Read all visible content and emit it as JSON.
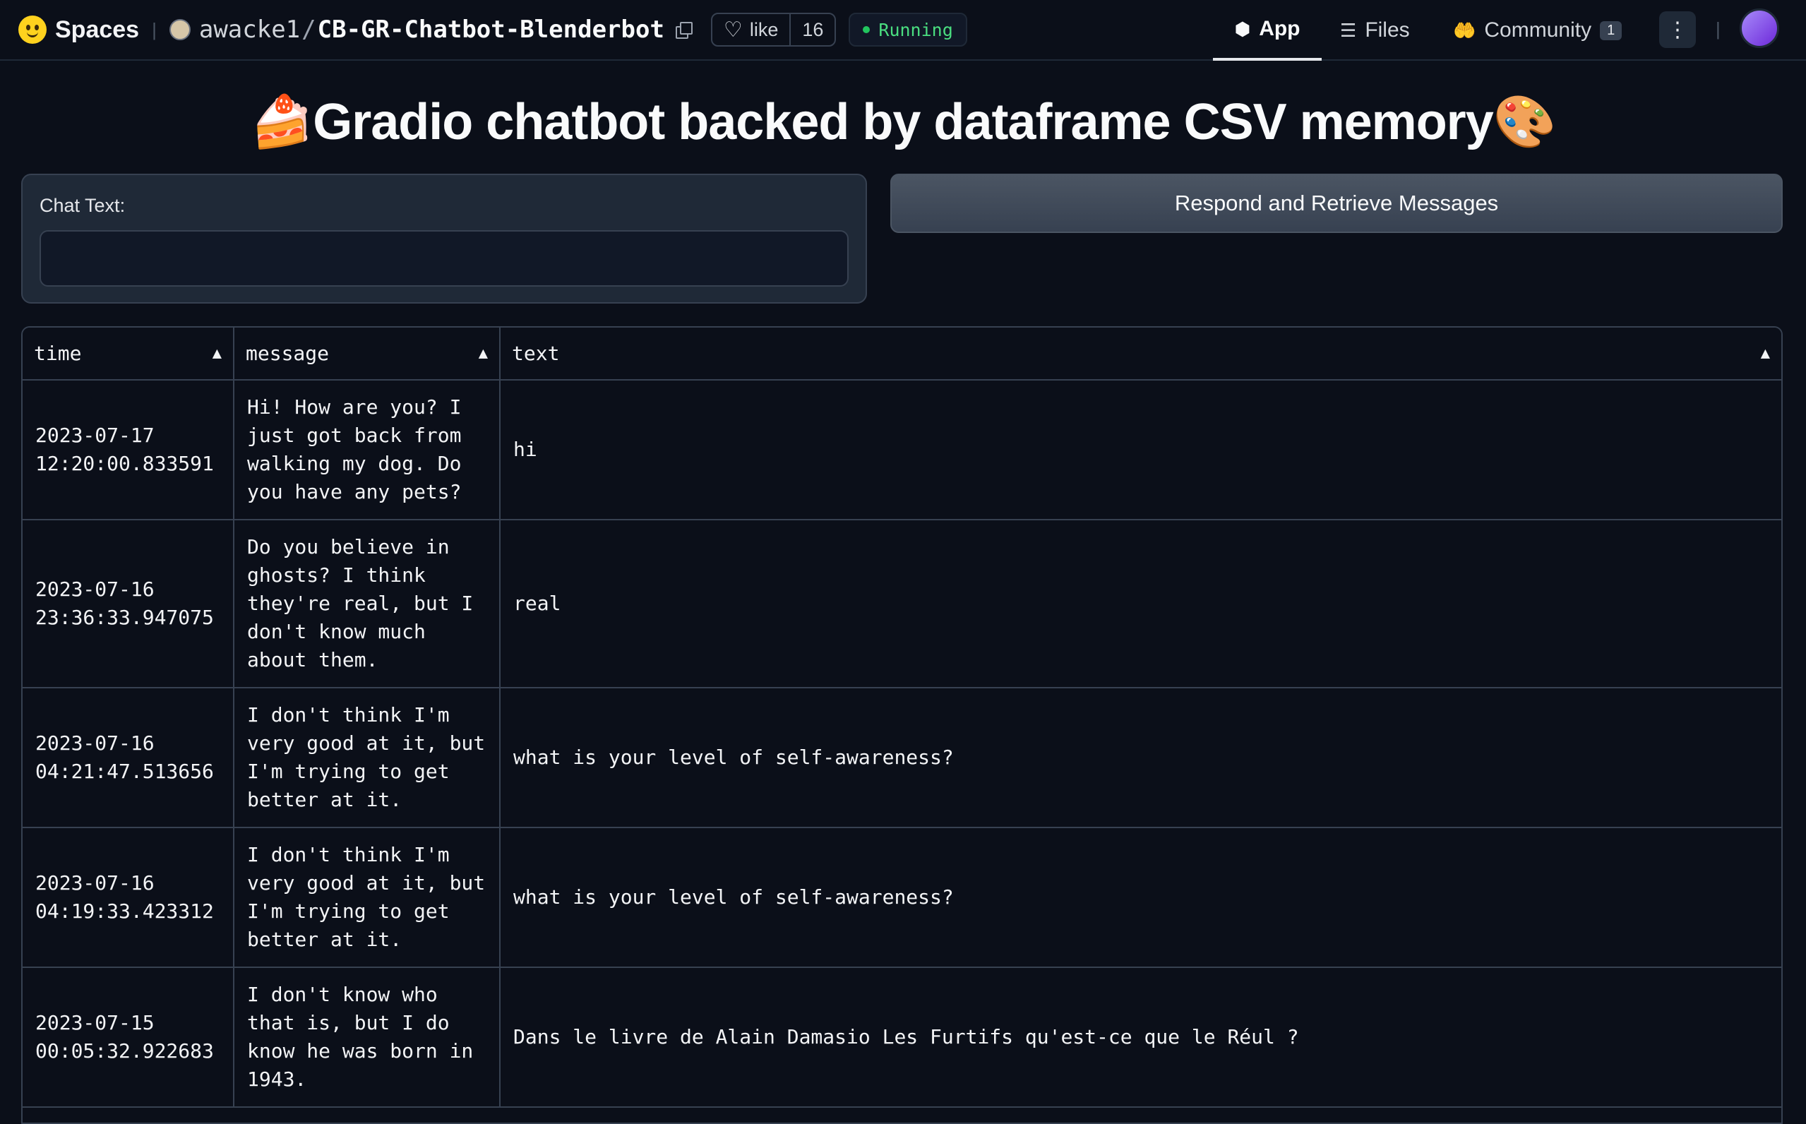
{
  "topbar": {
    "brand": "Spaces",
    "owner": "awacke1",
    "repo": "CB-GR-Chatbot-Blenderbot",
    "like_label": "like",
    "like_count": "16",
    "status": "Running",
    "nav": {
      "app": "App",
      "files": "Files",
      "community": "Community",
      "community_badge": "1"
    }
  },
  "page": {
    "title": "🍰Gradio chatbot backed by dataframe CSV memory🎨"
  },
  "chat": {
    "label": "Chat Text:",
    "value": "",
    "button_label": "Respond and Retrieve Messages"
  },
  "table": {
    "columns": [
      "time",
      "message",
      "text"
    ],
    "rows": [
      {
        "time": "2023-07-17\n12:20:00.833591",
        "message": "Hi! How are you? I\njust got back from\nwalking my dog. Do\nyou have any pets?",
        "text": "hi"
      },
      {
        "time": "2023-07-16\n23:36:33.947075",
        "message": "Do you believe in\nghosts? I think\nthey're real, but I\ndon't know much\nabout them.",
        "text": "real"
      },
      {
        "time": "2023-07-16\n04:21:47.513656",
        "message": "I don't think I'm\nvery good at it, but\nI'm trying to get\nbetter at it.",
        "text": "what is your level of self-awareness?"
      },
      {
        "time": "2023-07-16\n04:19:33.423312",
        "message": "I don't think I'm\nvery good at it, but\nI'm trying to get\nbetter at it.",
        "text": "what is your level of self-awareness?"
      },
      {
        "time": "2023-07-15\n00:05:32.922683",
        "message": "I don't know who\nthat is, but I do\nknow he was born in\n1943.",
        "text": "Dans le livre de Alain Damasio Les Furtifs qu'est-ce que le Réul ?"
      }
    ]
  }
}
